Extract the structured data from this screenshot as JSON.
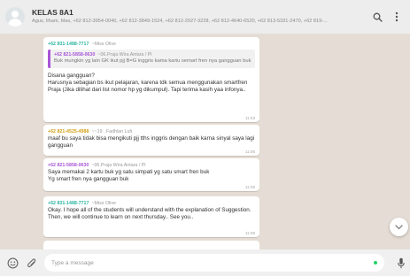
{
  "header": {
    "title": "KELAS 8A1",
    "participants": "Agus, Ilham, Mas, +62 812-3954-0040, +62 812-3849-1524, +62 812-2027-3228, +62 812-4640-6520, +62 813-5331-2470, +62 819-..."
  },
  "messages": [
    {
      "sender_phone": "+62 831-1488-7717",
      "sender_name": "~Miss Olive",
      "sender_color": "#2bb5a0",
      "quote": {
        "sender_phone": "+62 821-5858-0630",
        "sender_name": "~06.Praja Wira Antara / Pl",
        "text": "Buk mungkin yg lain GK ikut pjj B=G inggris kama kartu semart fren nya gangguan buk"
      },
      "text": "Disana gangguan?\nHarusnya sebagian bs ikut pelajaran, karena tdk semua menggunakan smartfren Praja (Jika dilihat dari list nomor hp yg dikumpul). Tapi terima kasih yaa infonya..",
      "time": "11:03"
    },
    {
      "sender_phone": "+62 821-4525-4988",
      "sender_name": "~~19 . Fadhlan Lufi",
      "sender_color": "#d4a017",
      "text": "maaf bu saya tidak bisa mengikuti pjj tths inggris dengan baik karna sinyal saya lagi gangguan",
      "time": "11:05"
    },
    {
      "sender_phone": "+62 821-5858-0630",
      "sender_name": "~06.Praja Wira Antara / Pl",
      "sender_color": "#a855d6",
      "text": "Saya memakai 2 kartu buk yg satu simpati yg satu smart fren buk\nYg smart fren nya gangguan buk",
      "time": "11:05"
    },
    {
      "sender_phone": "+62 831-1488-7717",
      "sender_name": "~Miss Olive",
      "sender_color": "#2bb5a0",
      "text": "Okay. I hope all of the students will understand with the explanation of Suggestion.\nThen, we will continue to learn on next thursday.. See you..",
      "time": "11:06"
    }
  ],
  "footer": {
    "placeholder": "Type a message"
  }
}
